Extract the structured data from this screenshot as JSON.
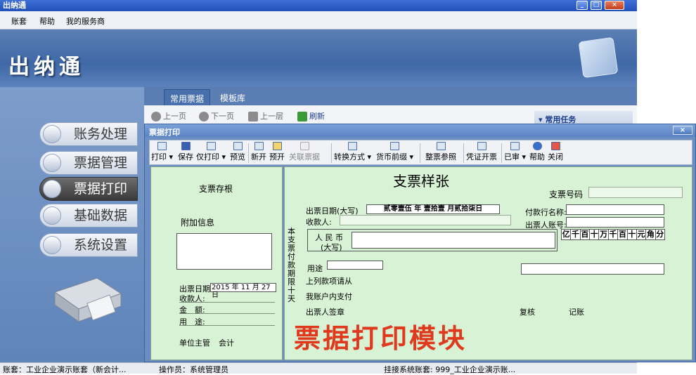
{
  "window": {
    "title": "出纳通",
    "controls": [
      "_",
      "□",
      "×"
    ]
  },
  "menu": [
    "账套",
    "帮助",
    "我的服务商"
  ],
  "banner": {
    "brand": "出纳通"
  },
  "sidebar": {
    "items": [
      {
        "label": "账务处理",
        "active": false
      },
      {
        "label": "票据管理",
        "active": false
      },
      {
        "label": "票据打印",
        "active": true
      },
      {
        "label": "基础数据",
        "active": false
      },
      {
        "label": "系统设置",
        "active": false
      }
    ]
  },
  "tabs": [
    "常用票据",
    "模板库"
  ],
  "nav": {
    "back": "上一页",
    "forward": "下一页",
    "up": "上一层",
    "refresh": "刷新"
  },
  "tasks": {
    "title": "常用任务"
  },
  "dialog": {
    "title": "票据打印",
    "close": "×",
    "toolbar": [
      "打印",
      "保存",
      "仅打印",
      "预览",
      "新开",
      "预开",
      "关联票据",
      "转换方式",
      "货币前缀",
      "整票参照",
      "凭证开票",
      "已审",
      "帮助",
      "关闭"
    ]
  },
  "stub": {
    "title": "支票存根",
    "extra": "附加信息",
    "date_label": "出票日期",
    "date_value": "2015 年  11 月 27 日",
    "payee": "收款人:",
    "amount": "金　额:",
    "purpose": "用　途:",
    "manager": "单位主管",
    "accountant": "会计"
  },
  "check": {
    "title": "支票样张",
    "no_label": "支票号码",
    "date_label": "出票日期(大写)",
    "date_value": "贰零壹伍 年  壹拾壹  月贰拾柒日",
    "bank_label": "付款行名称:",
    "payee_label": "收款人:",
    "account_label": "出票人账号:",
    "rmb_line1": "人 民 币",
    "rmb_line2": "(大写)",
    "digits": [
      "亿",
      "千",
      "百",
      "十",
      "万",
      "千",
      "百",
      "十",
      "元",
      "角",
      "分"
    ],
    "side_text": "本支票付款期限十天",
    "purpose_label": "用途",
    "note1": "上列款项请从",
    "note2": "我账户内支付",
    "drawer_sign": "出票人签章",
    "review": "复核",
    "bookkeeping": "记账"
  },
  "watermark": "票据打印模块",
  "status": {
    "account": "账套：工业企业演示账套（新会计...",
    "operator": "操作员：系统管理员",
    "mounted": "挂接系统账套: 999_工业企业演示账..."
  }
}
